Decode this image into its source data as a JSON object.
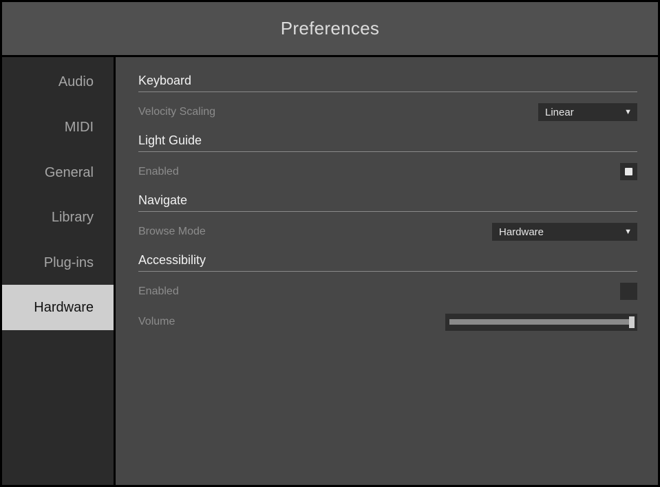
{
  "window": {
    "title": "Preferences"
  },
  "sidebar": {
    "items": [
      {
        "label": "Audio",
        "active": false
      },
      {
        "label": "MIDI",
        "active": false
      },
      {
        "label": "General",
        "active": false
      },
      {
        "label": "Library",
        "active": false
      },
      {
        "label": "Plug-ins",
        "active": false
      },
      {
        "label": "Hardware",
        "active": true
      }
    ]
  },
  "sections": {
    "keyboard": {
      "title": "Keyboard",
      "velocity_scaling": {
        "label": "Velocity Scaling",
        "value": "Linear"
      }
    },
    "light_guide": {
      "title": "Light Guide",
      "enabled": {
        "label": "Enabled",
        "checked": true
      }
    },
    "navigate": {
      "title": "Navigate",
      "browse_mode": {
        "label": "Browse Mode",
        "value": "Hardware"
      }
    },
    "accessibility": {
      "title": "Accessibility",
      "enabled": {
        "label": "Enabled",
        "checked": false
      },
      "volume": {
        "label": "Volume",
        "level": 1.0
      }
    }
  },
  "icons": {
    "dropdown_arrow": "triangle-down-icon",
    "checkbox_mark": "check-square-icon"
  },
  "colors": {
    "title_bg": "#505050",
    "sidebar_bg": "#2b2b2b",
    "content_bg": "#474747",
    "active_tab_bg": "#cfcfcf",
    "control_bg": "#2d2d2d"
  }
}
